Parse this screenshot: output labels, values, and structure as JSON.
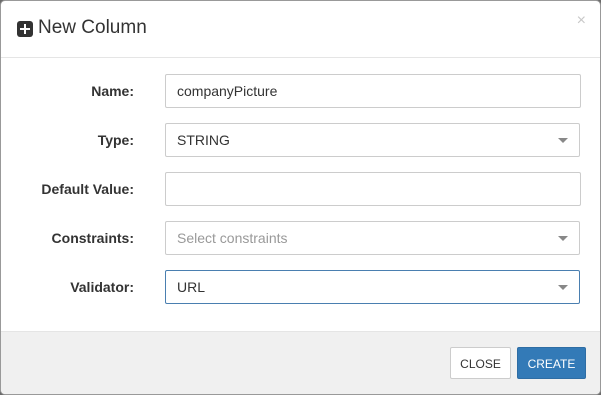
{
  "dialog": {
    "title": "New Column",
    "close_glyph": "×"
  },
  "form": {
    "name": {
      "label": "Name:",
      "value": "companyPicture"
    },
    "type": {
      "label": "Type:",
      "value": "STRING"
    },
    "default_value": {
      "label": "Default Value:",
      "value": ""
    },
    "constraints": {
      "label": "Constraints:",
      "placeholder": "Select constraints"
    },
    "validator": {
      "label": "Validator:",
      "value": "URL"
    }
  },
  "footer": {
    "close_label": "CLOSE",
    "create_label": "CREATE"
  },
  "colors": {
    "primary": "#337ab7",
    "focus_border": "#4a7fb0"
  },
  "icons": {
    "title": "plus-square-icon",
    "dropdown": "caret-down-icon"
  }
}
